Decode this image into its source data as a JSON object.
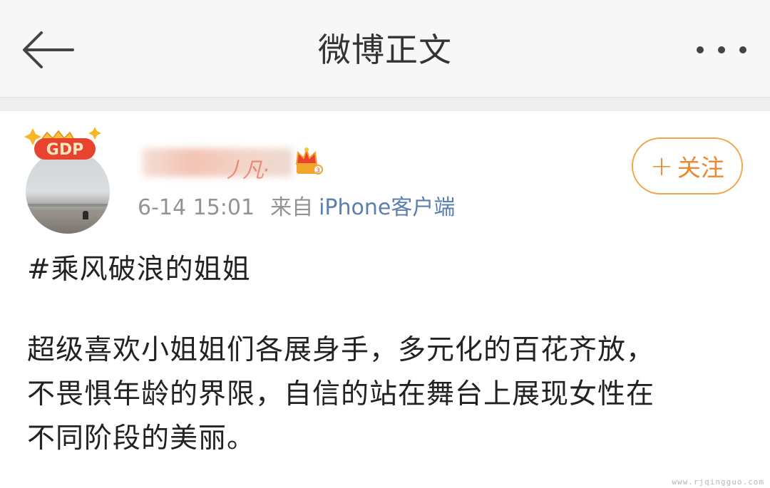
{
  "nav": {
    "back_icon": "arrow-left-icon",
    "title": "微博正文",
    "more_icon": "more-dots-icon"
  },
  "post": {
    "avatar_badge": "GDP",
    "username_visible": "丿凡·",
    "vip_icon": "crown-vip-icon",
    "time": "6-14 15:01",
    "source_label": "来自",
    "source": "iPhone客户端",
    "follow": {
      "plus": "+",
      "label": "关注",
      "color": "#f0a54a"
    },
    "topic": "#乘风破浪的姐姐",
    "body_lines": [
      "超级喜欢小姐姐们各展身手，多元化的百花齐放，",
      "不畏惧年龄的界限，自信的站在舞台上展现女性在",
      "不同阶段的美丽。"
    ]
  },
  "watermark": "www.rjqingguo.com",
  "colors": {
    "accent": "#e88a2f",
    "link": "#5b7fae",
    "meta": "#939393"
  }
}
